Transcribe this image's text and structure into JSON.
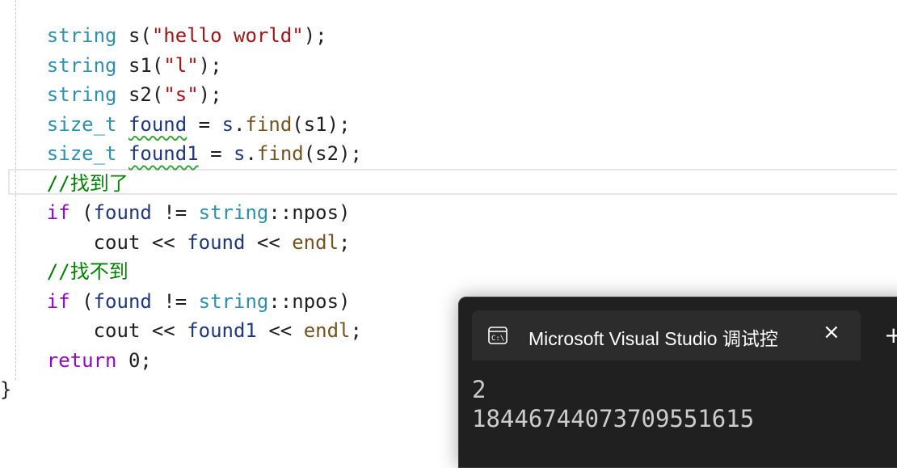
{
  "code": {
    "line1": {
      "type": "string",
      "var": "s",
      "open": "(",
      "str": "\"hello world\"",
      "close": ");"
    },
    "line2": {
      "type": "string",
      "var": "s1",
      "open": "(",
      "str": "\"l\"",
      "close": ");"
    },
    "line3": {
      "type": "string",
      "var": "s2",
      "open": "(",
      "str": "\"s\"",
      "close": ");"
    },
    "line4": {
      "type": "size_t",
      "var": "found",
      "eq": " = ",
      "obj": "s",
      "dot": ".",
      "fn": "find",
      "arg": "(s1);"
    },
    "line5": {
      "type": "size_t",
      "var": "found1",
      "eq": " = ",
      "obj": "s",
      "dot": ".",
      "fn": "find",
      "arg": "(s2);"
    },
    "line6": {
      "comment": "//找到了"
    },
    "line7": {
      "kw": "if",
      "a": " (",
      "var": "found",
      "op": " != ",
      "cls": "string",
      "b": "::npos)"
    },
    "line8": {
      "a": "cout",
      "op1": " << ",
      "var": "found",
      "op2": " << ",
      "fn": "endl",
      "b": ";"
    },
    "line9": {
      "comment": "//找不到"
    },
    "line10": {
      "kw": "if",
      "a": " (",
      "var": "found",
      "op": " != ",
      "cls": "string",
      "b": "::npos)"
    },
    "line11": {
      "a": "cout",
      "op1": " << ",
      "var": "found1",
      "op2": " << ",
      "fn": "endl",
      "b": ";"
    },
    "line12": {
      "kw": "return",
      "a": " 0;"
    },
    "line13": {
      "brace": "}"
    }
  },
  "console": {
    "title": "Microsoft Visual Studio 调试控",
    "close_icon": "×",
    "new_tab_icon": "+",
    "output": [
      "2",
      "18446744073709551615"
    ]
  }
}
